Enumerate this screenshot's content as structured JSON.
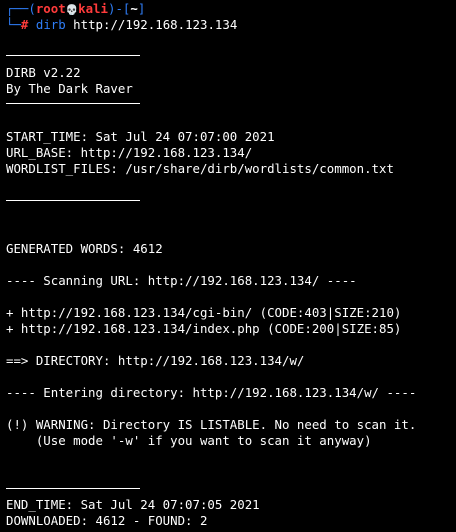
{
  "prompt": {
    "box_top_left": "┌──(",
    "user": "root",
    "skull": "💀",
    "host": "kali",
    "cwd_open": ")-[",
    "cwd": "~",
    "cwd_close": "]",
    "box_bottom_left": "└─",
    "hash": "#",
    "command": "dirb",
    "argument": "http://192.168.123.134"
  },
  "banner": {
    "version": "DIRB v2.22",
    "author": "By The Dark Raver"
  },
  "info": {
    "start_time": "START_TIME: Sat Jul 24 07:07:00 2021",
    "url_base": "URL_BASE: http://192.168.123.134/",
    "wordlist": "WORDLIST_FILES: /usr/share/dirb/wordlists/common.txt"
  },
  "generated_words": "GENERATED WORDS: 4612",
  "scanning": "---- Scanning URL: http://192.168.123.134/ ----",
  "results": [
    "+ http://192.168.123.134/cgi-bin/ (CODE:403|SIZE:210)",
    "+ http://192.168.123.134/index.php (CODE:200|SIZE:85)"
  ],
  "directory": "==> DIRECTORY: http://192.168.123.134/w/",
  "entering": "---- Entering directory: http://192.168.123.134/w/ ----",
  "warning": {
    "line1": "(!) WARNING: Directory IS LISTABLE. No need to scan it.",
    "line2": "    (Use mode '-w' if you want to scan it anyway)"
  },
  "footer": {
    "end_time": "END_TIME: Sat Jul 24 07:07:05 2021",
    "downloaded": "DOWNLOADED: 4612 - FOUND: 2"
  }
}
